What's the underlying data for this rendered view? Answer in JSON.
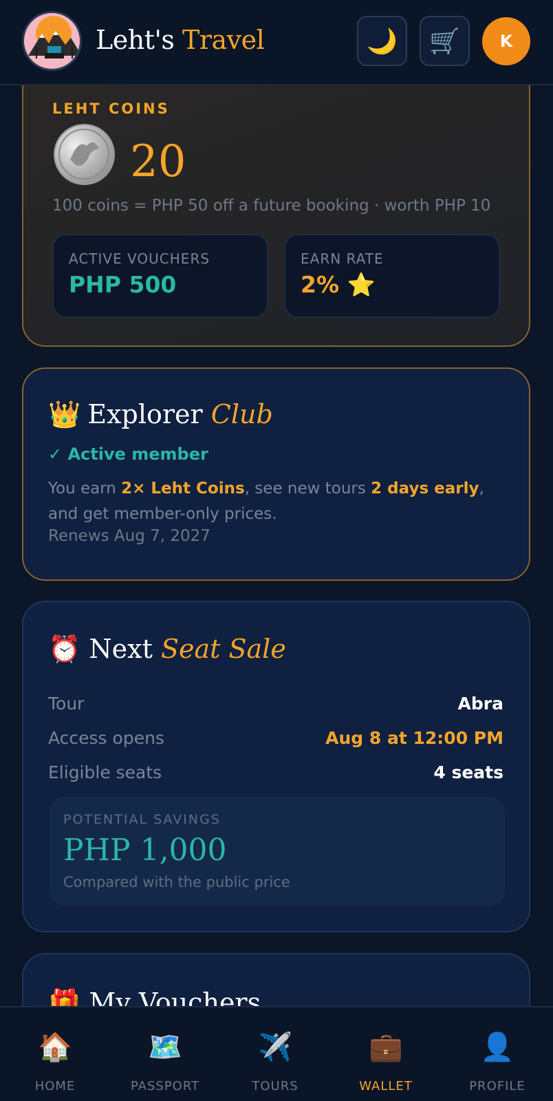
{
  "header": {
    "brand_prefix": "Leht's ",
    "brand_accent": "Travel",
    "theme_icon": "🌙",
    "cart_icon": "🛒",
    "avatar_initial": "K"
  },
  "coins": {
    "title": "LEHT COINS",
    "value": "20",
    "note": "100 coins = PHP 50 off a future booking · worth PHP 10",
    "vouchers_label": "ACTIVE VOUCHERS",
    "vouchers_value": "PHP 500",
    "earn_label": "EARN RATE",
    "earn_value": "2% ⭐"
  },
  "club": {
    "icon": "👑",
    "title_main": "Explorer ",
    "title_accent": "Club",
    "status": "✓ Active member",
    "desc_1": "You earn ",
    "desc_b1": "2× Leht Coins",
    "desc_2": ", see new tours ",
    "desc_b2": "2 days early",
    "desc_3": ", and get member-only prices.",
    "renews": "Renews Aug 7, 2027"
  },
  "sale": {
    "icon": "⏰",
    "title_main": "Next ",
    "title_accent": "Seat Sale",
    "rows": [
      {
        "k": "Tour",
        "v": "Abra"
      },
      {
        "k": "Access opens",
        "v": "Aug 8 at 12:00 PM"
      },
      {
        "k": "Eligible seats",
        "v": "4 seats"
      }
    ],
    "savings_label": "POTENTIAL SAVINGS",
    "savings_value": "PHP 1,000",
    "savings_note": "Compared with the public price"
  },
  "vouchers": {
    "icon": "🎁",
    "title": "My Vouchers"
  },
  "nav": [
    {
      "icon": "🏠",
      "label": "HOME"
    },
    {
      "icon": "🗺️",
      "label": "PASSPORT"
    },
    {
      "icon": "✈️",
      "label": "TOURS"
    },
    {
      "icon": "💼",
      "label": "WALLET"
    },
    {
      "icon": "👤",
      "label": "PROFILE"
    }
  ],
  "colors": {
    "accent": "#f5a52a",
    "teal": "#2bb7a6",
    "background": "#0b1628"
  }
}
